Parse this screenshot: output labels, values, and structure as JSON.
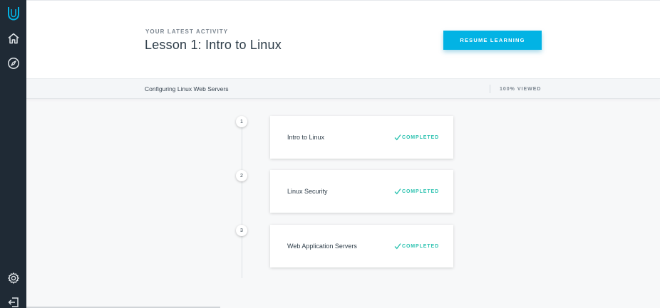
{
  "sidebar": {
    "items": [
      {
        "icon": "udacity-logo-icon"
      },
      {
        "icon": "home-icon"
      },
      {
        "icon": "compass-icon"
      },
      {
        "icon": "gear-icon"
      },
      {
        "icon": "logout-icon"
      }
    ],
    "icon_color": "#dfe4e8",
    "logo_color": "#02b3e4"
  },
  "header": {
    "eyebrow": "YOUR LATEST ACTIVITY",
    "title": "Lesson 1: Intro to Linux",
    "resume_label": "RESUME LEARNING"
  },
  "subbar": {
    "course_name": "Configuring Linux Web Servers",
    "viewed": "100% VIEWED"
  },
  "lessons": [
    {
      "number": "1",
      "title": "Intro to Linux",
      "status": "COMPLETED"
    },
    {
      "number": "2",
      "title": "Linux Security",
      "status": "COMPLETED"
    },
    {
      "number": "3",
      "title": "Web Application Servers",
      "status": "COMPLETED"
    }
  ],
  "colors": {
    "accent": "#02b3e4",
    "completed": "#2fc3b1",
    "sidebar_bg": "#1f2a35"
  }
}
